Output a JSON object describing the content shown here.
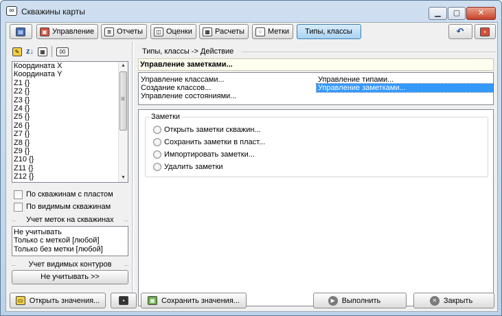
{
  "window": {
    "title": "Скважины карты"
  },
  "toolbar": {
    "tabs": [
      {
        "label": "Управление",
        "icon": "management-icon"
      },
      {
        "label": "Отчеты",
        "icon": "reports-icon"
      },
      {
        "label": "Оценки",
        "icon": "estimates-icon"
      },
      {
        "label": "Расчеты",
        "icon": "calculator-icon"
      },
      {
        "label": "Метки",
        "icon": "marks-icon"
      },
      {
        "label": "Типы, классы",
        "active": true
      }
    ]
  },
  "left": {
    "variables": [
      "Координата X",
      "Координата Y",
      "Z1 {}",
      "Z2 {}",
      "Z3 {}",
      "Z4 {}",
      "Z5 {}",
      "Z6 {}",
      "Z7 {}",
      "Z8 {}",
      "Z9 {}",
      "Z10 {}",
      "Z11 {}",
      "Z12 {}"
    ],
    "checkbox_wells_with_layer": "По скважинам с пластом",
    "checkbox_visible_wells": "По видимым скважинам",
    "marks_group_label": "Учет меток на скважинах",
    "marks_options": [
      "Не учитывать",
      "Только с меткой   [любой]",
      "Только без метки [любой]"
    ],
    "contours_group_label": "Учет видимых контуров",
    "contours_button": "Не учитывать  >>"
  },
  "right": {
    "breadcrumb": "Типы, классы -> Действие",
    "action_title": "Управление заметками...",
    "options_left": [
      "Управление классами...",
      "Создание классов...",
      "Управление состояниями..."
    ],
    "options_right": [
      "Управление типами...",
      "Управление заметками..."
    ],
    "selected_option": "Управление заметками...",
    "notes_group": {
      "legend": "Заметки",
      "radios": [
        "Открыть заметки скважин...",
        "Сохранить заметки в пласт...",
        "Импортировать заметки...",
        "Удалить заметки"
      ]
    }
  },
  "bottom": {
    "open_values": "Открыть значения...",
    "save_values": "Сохранить значения...",
    "run": "Выполнить",
    "close": "Закрыть"
  },
  "colors": {
    "selection": "#3399ff",
    "active_tab": "#a9d2f2",
    "action_bar": "#fffff0"
  }
}
